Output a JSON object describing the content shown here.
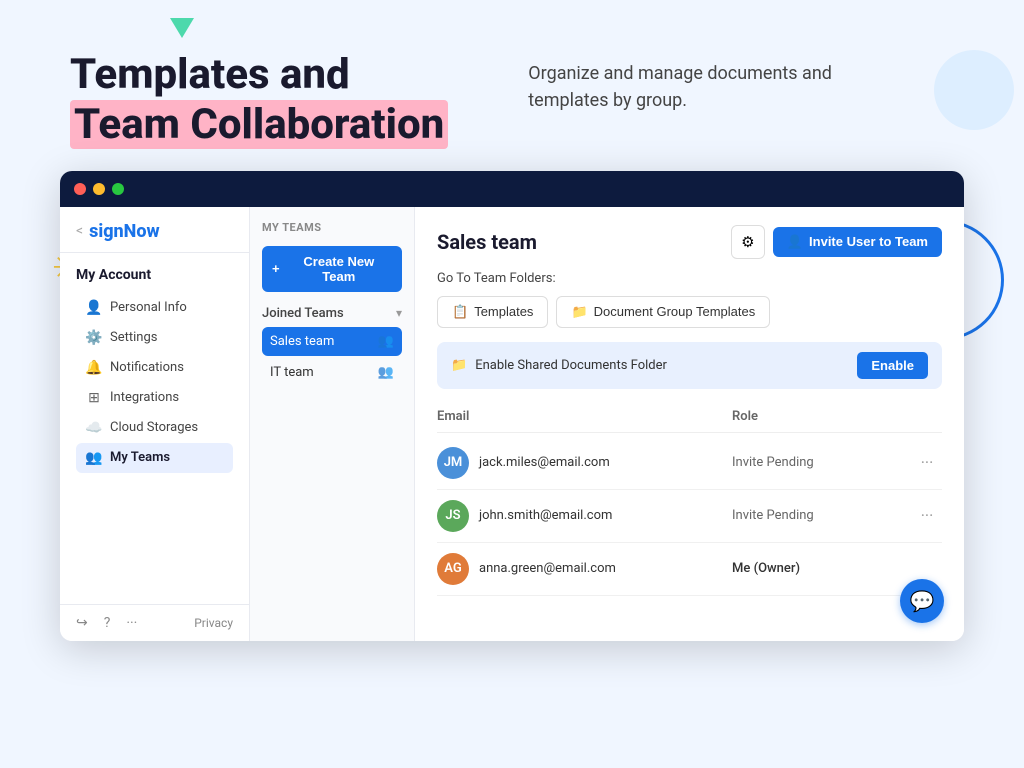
{
  "page": {
    "title": "Templates and Team Collaboration",
    "title_line1": "Templates and",
    "title_line2": "Team Collaboration",
    "highlight": "Team Collaboration",
    "description": "Organize and manage documents and templates by group."
  },
  "window": {
    "dots": [
      "red",
      "yellow",
      "green"
    ]
  },
  "sidebar": {
    "back_label": "<",
    "logo": "signNow",
    "account_title": "My Account",
    "nav_items": [
      {
        "id": "personal-info",
        "label": "Personal Info",
        "icon": "👤"
      },
      {
        "id": "settings",
        "label": "Settings",
        "icon": "⚙️"
      },
      {
        "id": "notifications",
        "label": "Notifications",
        "icon": "🔔"
      },
      {
        "id": "integrations",
        "label": "Integrations",
        "icon": "⊞"
      },
      {
        "id": "cloud-storages",
        "label": "Cloud Storages",
        "icon": "☁️"
      },
      {
        "id": "my-teams",
        "label": "My Teams",
        "icon": "👥",
        "active": true
      }
    ],
    "footer": {
      "logout_icon": "↪",
      "help_icon": "?",
      "more_icon": "...",
      "privacy_label": "Privacy"
    }
  },
  "teams_panel": {
    "section_title": "MY TEAMS",
    "create_button": "+ Create New Team",
    "joined_label": "Joined Teams",
    "teams": [
      {
        "id": "sales-team",
        "label": "Sales team",
        "active": true
      },
      {
        "id": "it-team",
        "label": "IT team",
        "active": false
      }
    ]
  },
  "main": {
    "team_title": "Sales team",
    "gear_icon": "⚙",
    "invite_button": "Invite User to Team",
    "invite_icon": "👤",
    "goto_folders": "Go To Team Folders:",
    "folder_tabs": [
      {
        "id": "templates",
        "label": "Templates",
        "icon": "📋"
      },
      {
        "id": "document-group-templates",
        "label": "Document Group Templates",
        "icon": "📁"
      }
    ],
    "shared_folder_banner": {
      "icon": "📁",
      "text": "Enable Shared Documents Folder",
      "button_label": "Enable"
    },
    "table": {
      "col_email": "Email",
      "col_role": "Role",
      "members": [
        {
          "id": "member-1",
          "email": "jack.miles@email.com",
          "role": "Invite Pending",
          "avatar_color": "#4a90d9",
          "initials": "JM"
        },
        {
          "id": "member-2",
          "email": "john.smith@email.com",
          "role": "Invite Pending",
          "avatar_color": "#5ba85b",
          "initials": "JS"
        },
        {
          "id": "member-3",
          "email": "anna.green@email.com",
          "role": "Me (Owner)",
          "avatar_color": "#e07b39",
          "initials": "AG"
        }
      ]
    },
    "chat_icon": "💬"
  }
}
